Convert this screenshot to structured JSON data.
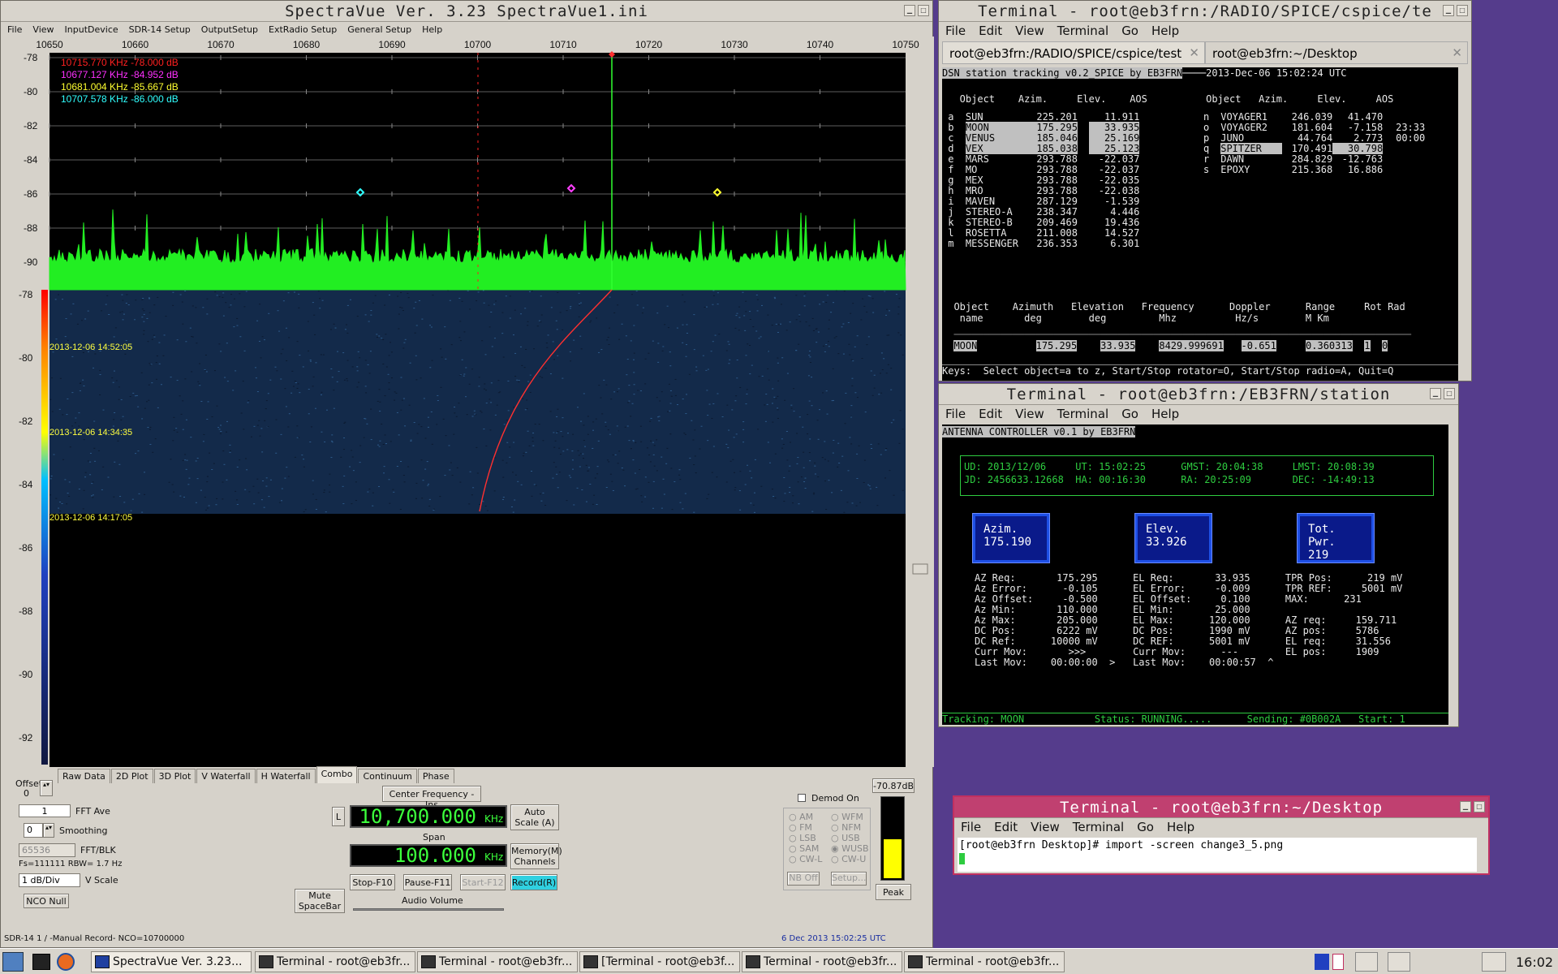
{
  "spectravue": {
    "title": "SpectraVue Ver. 3.23 SpectraVue1.ini",
    "menu": [
      "File",
      "View",
      "InputDevice",
      "SDR-14 Setup",
      "OutputSetup",
      "ExtRadio Setup",
      "General Setup",
      "Help"
    ],
    "freq_ticks": [
      "10650",
      "10660",
      "10670",
      "10680",
      "10690",
      "10700",
      "10710",
      "10720",
      "10730",
      "10740",
      "10750"
    ],
    "db_ticks": [
      "-78",
      "-80",
      "-82",
      "-84",
      "-86",
      "-88",
      "-90"
    ],
    "wf_ticks": [
      "-78",
      "-80",
      "-82",
      "-84",
      "-86",
      "-88",
      "-90",
      "-92"
    ],
    "markers": [
      {
        "text": "10715.770 KHz  -78.000 dB",
        "color": "#ff2020"
      },
      {
        "text": "10677.127 KHz  -84.952 dB",
        "color": "#ff30ff"
      },
      {
        "text": "10681.004 KHz  -85.667 dB",
        "color": "#ffff30"
      },
      {
        "text": "10707.578 KHz  -86.000 dB",
        "color": "#30ffff"
      }
    ],
    "timestamps": [
      "2013-12-06 14:52:05",
      "2013-12-06 14:34:35",
      "2013-12-06 14:17:05"
    ],
    "tabs": [
      "Raw Data",
      "2D Plot",
      "3D Plot",
      "V Waterfall",
      "H Waterfall",
      "Combo",
      "Continuum",
      "Phase"
    ],
    "offset_label": "Offset",
    "offset_value": "0",
    "fft_ave_value": "1",
    "fft_ave_label": "FFT Ave",
    "smoothing_value": "0",
    "smoothing_label": "Smoothing",
    "fft_blk_value": "65536",
    "fft_blk_label": "FFT/BLK",
    "fs_rbw": "Fs=111111 RBW= 1.7 Hz",
    "vscale_value": "1 dB/Div",
    "vscale_label": "V Scale",
    "nco_null": "NCO Null",
    "center_freq_btn": "Center Frequency - Ins",
    "l_btn": "L",
    "center_freq": "10,700.000",
    "khz": "KHz",
    "span_label": "Span",
    "span_value": "100.000",
    "auto_scale": "Auto Scale (A)",
    "memory": "Memory(M) Channels",
    "stop": "Stop-F10",
    "pause": "Pause-F11",
    "start": "Start-F12",
    "record": "Record(R)",
    "mute": "Mute SpaceBar",
    "audio_volume": "Audio Volume",
    "demod_on": "Demod On",
    "modes_left": [
      "AM",
      "FM",
      "LSB",
      "SAM",
      "CW-L"
    ],
    "modes_right": [
      "WFM",
      "NFM",
      "USB",
      "WUSB",
      "CW-U"
    ],
    "nb_off": "NB Off",
    "setup": "Setup...",
    "level": "-70.87dB",
    "peak": "Peak",
    "status_left": "SDR-14 1  / -Manual Record-   NCO=10700000",
    "status_right": "6 Dec 2013  15:02:25 UTC"
  },
  "term1": {
    "title": "Terminal - root@eb3frn:/RADIO/SPICE/cspice/te",
    "menu": [
      "File",
      "Edit",
      "View",
      "Terminal",
      "Go",
      "Help"
    ],
    "tab1": "root@eb3frn:/RADIO/SPICE/cspice/test",
    "tab2": "root@eb3frn:~/Desktop",
    "header": "DSN station tracking v0.2_SPICE by EB3FRN",
    "datetime": "2013-Dec-06 15:02:24 UTC",
    "col_headers": "   Object    Azim.     Elev.    AOS          Object   Azim.     Elev.     AOS",
    "rows_left": [
      [
        "a",
        "SUN",
        "225.201",
        "11.911"
      ],
      [
        "b",
        "MOON",
        "175.295",
        "33.935"
      ],
      [
        "c",
        "VENUS",
        "185.046",
        "25.169"
      ],
      [
        "d",
        "VEX",
        "185.038",
        "25.123"
      ],
      [
        "e",
        "MARS",
        "293.788",
        "-22.037"
      ],
      [
        "f",
        "MO",
        "293.788",
        "-22.037"
      ],
      [
        "g",
        "MEX",
        "293.788",
        "-22.035"
      ],
      [
        "h",
        "MRO",
        "293.788",
        "-22.038"
      ],
      [
        "i",
        "MAVEN",
        "287.129",
        "-1.539"
      ],
      [
        "j",
        "STEREO-A",
        "238.347",
        "4.446"
      ],
      [
        "k",
        "STEREO-B",
        "209.469",
        "19.436"
      ],
      [
        "l",
        "ROSETTA",
        "211.008",
        "14.527"
      ],
      [
        "m",
        "MESSENGER",
        "236.353",
        "6.301"
      ]
    ],
    "rows_right": [
      [
        "n",
        "VOYAGER1",
        "246.039",
        "41.470",
        ""
      ],
      [
        "o",
        "VOYAGER2",
        "181.604",
        "-7.158",
        "23:33"
      ],
      [
        "p",
        "JUNO",
        "44.764",
        "2.773",
        "00:00"
      ],
      [
        "q",
        "SPITZER",
        "170.491",
        "30.798",
        ""
      ],
      [
        "r",
        "DAWN",
        "284.829",
        "-12.763",
        ""
      ],
      [
        "s",
        "EPOXY",
        "215.368",
        "16.886",
        ""
      ]
    ],
    "sel_head1": "  Object    Azimuth   Elevation   Frequency      Doppler      Range     Rot Rad",
    "sel_head2": "   name       deg        deg         Mhz          Hz/s        M Km",
    "sel": [
      "MOON",
      "175.295",
      "33.935",
      "8429.999691",
      "-0.651",
      "0.360313",
      "1",
      "0"
    ],
    "keys": "Keys:  Select object=a to z, Start/Stop rotator=O, Start/Stop radio=A, Quit=Q"
  },
  "term2": {
    "title": "Terminal - root@eb3frn:/EB3FRN/station",
    "menu": [
      "File",
      "Edit",
      "View",
      "Terminal",
      "Go",
      "Help"
    ],
    "header": "ANTENNA CONTROLLER v0.1 by EB3FRN",
    "time1": "UD: 2013/12/06     UT: 15:02:25      GMST: 20:04:38     LMST: 20:08:39",
    "time2": "JD: 2456633.12668  HA: 00:16:30      RA: 20:25:09       DEC: -14:49:13",
    "azim_label": "Azim.",
    "azim": "175.190",
    "elev_label": "Elev.",
    "elev": "33.926",
    "tpwr_label": "Tot. Pwr.",
    "tpwr": "219",
    "lines": [
      "AZ Req:       175.295      EL Req:       33.935      TPR Pos:      219 mV",
      "Az Error:      -0.105      EL Error:     -0.009      TPR REF:     5001 mV",
      "Az Offset:     -0.500      EL Offset:     0.100      MAX:      231",
      "Az Min:       110.000      EL Min:       25.000",
      "Az Max:       205.000      EL Max:      120.000      AZ req:     159.711",
      "DC Pos:       6222 mV      DC Pos:      1990 mV      AZ pos:     5786",
      "DC Ref:      10000 mV      DC REF:      5001 mV      EL req:     31.556",
      "Curr Mov:       >>>        Curr Mov:      ---        EL pos:     1909",
      "Last Mov:    00:00:00  >   Last Mov:    00:00:57  ^"
    ],
    "status": "Tracking: MOON            Status: RUNNING.....      Sending: #0B002A   Start: 1"
  },
  "term3": {
    "title": "Terminal - root@eb3frn:~/Desktop",
    "menu": [
      "File",
      "Edit",
      "View",
      "Terminal",
      "Go",
      "Help"
    ],
    "prompt": "[root@eb3frn Desktop]# import -screen change3_5.png"
  },
  "taskbar": {
    "tasks": [
      "SpectraVue Ver. 3.23...",
      "Terminal - root@eb3fr...",
      "Terminal - root@eb3fr...",
      "[Terminal - root@eb3f...",
      "Terminal - root@eb3fr...",
      "Terminal - root@eb3fr..."
    ],
    "clock": "16:02"
  }
}
